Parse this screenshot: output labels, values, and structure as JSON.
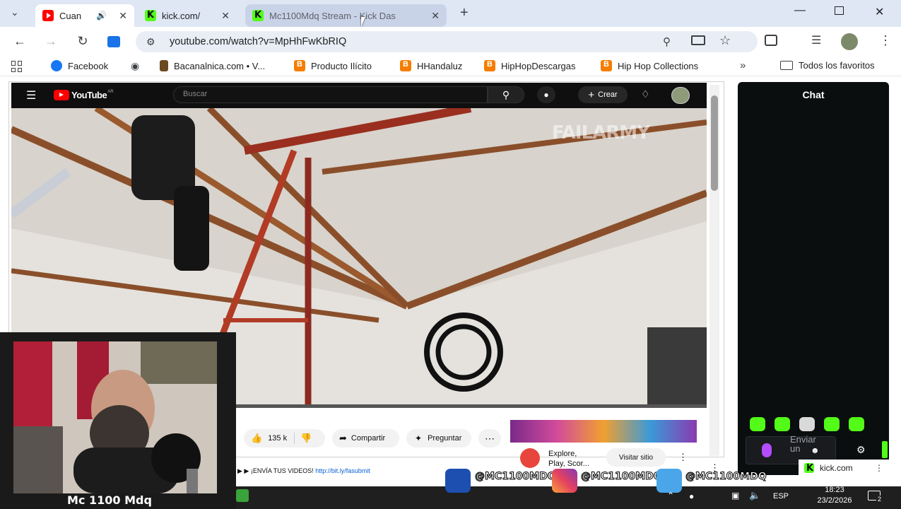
{
  "browser": {
    "tabs": [
      {
        "title": "Cuan",
        "favicon": "youtube-icon",
        "audio": true,
        "active": true
      },
      {
        "title": "kick.com/",
        "favicon": "kick-icon",
        "active": false
      },
      {
        "title": "Mc1100Mdq Stream - Kick Das",
        "favicon": "kick-icon",
        "active": false
      }
    ],
    "url": "youtube.com/watch?v=MpHhFwKbRIQ",
    "bookmarks": [
      {
        "label": "Facebook"
      },
      {
        "label": "Bacanalnica.com • V..."
      },
      {
        "label": "Producto Ilícito"
      },
      {
        "label": "HHandaluz"
      },
      {
        "label": "HipHopDescargas"
      },
      {
        "label": "Hip Hop Collections"
      }
    ],
    "all_bookmarks": "Todos los favoritos"
  },
  "youtube": {
    "logo": "YouTube",
    "region": "AR",
    "search_placeholder": "Buscar",
    "create_label": "Crear",
    "watermark": "FAILARMY",
    "likes": "135 k",
    "share_label": "Compartir",
    "ask_label": "Preguntar",
    "description": "▶ ▶ ¡ENVÍA TUS VIDEOS!",
    "description_link": "http://bit.ly/fasubmit",
    "ad": {
      "text_line1": "Explore,",
      "text_line2": "Play, Scor...",
      "visit": "Visitar sitio"
    }
  },
  "kick_chat": {
    "title": "Chat",
    "send_line1": "Enviar",
    "send_line2": "un",
    "popup_label": "kick.com"
  },
  "webcam": {
    "streamer_name": "Mc 1100 Mdq"
  },
  "overlay": {
    "handles": [
      "@MC1100MDQ",
      "@MC1100MDQ",
      "@MC1100MDQ"
    ]
  },
  "taskbar": {
    "language": "ESP",
    "time": "18:23",
    "date": "23/2/2026",
    "notifications": "2"
  },
  "colors": {
    "kick_green": "#53fc18",
    "youtube_red": "#ff0000",
    "tab_strip": "#dfe7f5"
  }
}
